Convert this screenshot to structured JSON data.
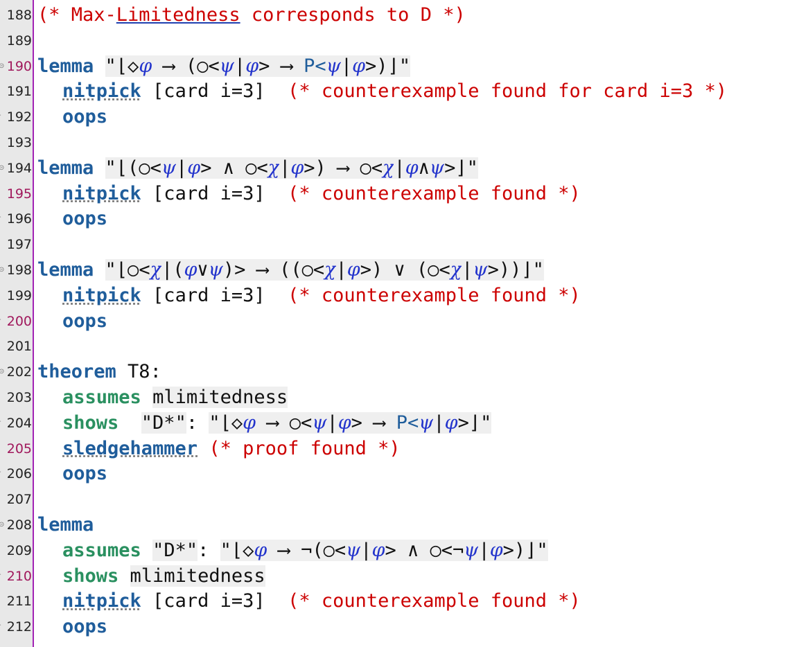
{
  "editor": {
    "lines": [
      {
        "num": "188",
        "modified": false,
        "fold": false,
        "indent": false,
        "parts": [
          {
            "t": "(* Max-",
            "c": "cm"
          },
          {
            "t": "Limitedness",
            "c": "cm link"
          },
          {
            "t": " corresponds to D *)",
            "c": "cm"
          }
        ]
      },
      {
        "num": "189",
        "modified": false,
        "fold": false,
        "indent": false,
        "parts": []
      },
      {
        "num": "190",
        "modified": true,
        "fold": true,
        "indent": false,
        "parts": [
          {
            "t": "lemma",
            "c": "kw"
          },
          {
            "t": " "
          },
          {
            "t": "\"⌊◇",
            "c": "str"
          },
          {
            "t": "φ",
            "c": "str var"
          },
          {
            "t": " ⟶ (○<",
            "c": "str"
          },
          {
            "t": "ψ",
            "c": "str var"
          },
          {
            "t": "|",
            "c": "str"
          },
          {
            "t": "φ",
            "c": "str var"
          },
          {
            "t": "> ⟶ ",
            "c": "str"
          },
          {
            "t": "P<",
            "c": "str P"
          },
          {
            "t": "ψ",
            "c": "str var"
          },
          {
            "t": "|",
            "c": "str"
          },
          {
            "t": "φ",
            "c": "str var"
          },
          {
            "t": ">)⌋\"",
            "c": "str"
          }
        ]
      },
      {
        "num": "191",
        "modified": false,
        "fold": false,
        "indent": true,
        "parts": [
          {
            "t": "nitpick",
            "c": "kw wavy"
          },
          {
            "t": " [card i=3]  "
          },
          {
            "t": "(* counterexample found for card i=3 *)",
            "c": "cm"
          }
        ]
      },
      {
        "num": "192",
        "modified": false,
        "fold": false,
        "indent": true,
        "dash": true,
        "parts": [
          {
            "t": "oops",
            "c": "kw"
          }
        ]
      },
      {
        "num": "193",
        "modified": false,
        "fold": false,
        "indent": false,
        "parts": []
      },
      {
        "num": "194",
        "modified": false,
        "fold": true,
        "indent": false,
        "parts": [
          {
            "t": "lemma",
            "c": "kw"
          },
          {
            "t": " "
          },
          {
            "t": "\"⌊(○<",
            "c": "str"
          },
          {
            "t": "ψ",
            "c": "str var"
          },
          {
            "t": "|",
            "c": "str"
          },
          {
            "t": "φ",
            "c": "str var"
          },
          {
            "t": "> ∧ ○<",
            "c": "str"
          },
          {
            "t": "χ",
            "c": "str var"
          },
          {
            "t": "|",
            "c": "str"
          },
          {
            "t": "φ",
            "c": "str var"
          },
          {
            "t": ">) ⟶ ○<",
            "c": "str"
          },
          {
            "t": "χ",
            "c": "str var"
          },
          {
            "t": "|",
            "c": "str"
          },
          {
            "t": "φ",
            "c": "str var"
          },
          {
            "t": "∧",
            "c": "str"
          },
          {
            "t": "ψ",
            "c": "str var"
          },
          {
            "t": ">⌋\"",
            "c": "str"
          }
        ]
      },
      {
        "num": "195",
        "modified": true,
        "fold": false,
        "indent": true,
        "parts": [
          {
            "t": "nitpick",
            "c": "kw wavy"
          },
          {
            "t": " [card i=3]  "
          },
          {
            "t": "(* counterexample found *)",
            "c": "cm"
          }
        ]
      },
      {
        "num": "196",
        "modified": false,
        "fold": false,
        "indent": true,
        "dash": true,
        "parts": [
          {
            "t": "oops",
            "c": "kw"
          }
        ]
      },
      {
        "num": "197",
        "modified": false,
        "fold": false,
        "indent": false,
        "parts": []
      },
      {
        "num": "198",
        "modified": false,
        "fold": true,
        "indent": false,
        "parts": [
          {
            "t": "lemma",
            "c": "kw"
          },
          {
            "t": " "
          },
          {
            "t": "\"⌊○<",
            "c": "str"
          },
          {
            "t": "χ",
            "c": "str var"
          },
          {
            "t": "|(",
            "c": "str"
          },
          {
            "t": "φ",
            "c": "str var"
          },
          {
            "t": "∨",
            "c": "str"
          },
          {
            "t": "ψ",
            "c": "str var"
          },
          {
            "t": ")> ⟶ ((○<",
            "c": "str"
          },
          {
            "t": "χ",
            "c": "str var"
          },
          {
            "t": "|",
            "c": "str"
          },
          {
            "t": "φ",
            "c": "str var"
          },
          {
            "t": ">) ∨ (○<",
            "c": "str"
          },
          {
            "t": "χ",
            "c": "str var"
          },
          {
            "t": "|",
            "c": "str"
          },
          {
            "t": "ψ",
            "c": "str var"
          },
          {
            "t": ">))⌋\"",
            "c": "str"
          }
        ]
      },
      {
        "num": "199",
        "modified": false,
        "fold": false,
        "indent": true,
        "parts": [
          {
            "t": "nitpick",
            "c": "kw wavy"
          },
          {
            "t": " [card i=3]  "
          },
          {
            "t": "(* counterexample found *)",
            "c": "cm"
          }
        ]
      },
      {
        "num": "200",
        "modified": true,
        "fold": false,
        "indent": true,
        "dash": true,
        "parts": [
          {
            "t": "oops",
            "c": "kw"
          }
        ]
      },
      {
        "num": "201",
        "modified": false,
        "fold": false,
        "indent": false,
        "parts": []
      },
      {
        "num": "202",
        "modified": false,
        "fold": true,
        "indent": false,
        "parts": [
          {
            "t": "theorem",
            "c": "kw"
          },
          {
            "t": " T8:"
          }
        ]
      },
      {
        "num": "203",
        "modified": false,
        "fold": false,
        "indent": true,
        "parts": [
          {
            "t": "assumes",
            "c": "kw2"
          },
          {
            "t": " "
          },
          {
            "t": "mlimitedness",
            "c": "str"
          }
        ]
      },
      {
        "num": "204",
        "modified": false,
        "fold": false,
        "indent": true,
        "dash": true,
        "parts": [
          {
            "t": "shows",
            "c": "kw2"
          },
          {
            "t": "  "
          },
          {
            "t": "\"D*\"",
            "c": "str"
          },
          {
            "t": ": "
          },
          {
            "t": "\"⌊◇",
            "c": "str"
          },
          {
            "t": "φ",
            "c": "str var"
          },
          {
            "t": " ⟶ ○<",
            "c": "str"
          },
          {
            "t": "ψ",
            "c": "str var"
          },
          {
            "t": "|",
            "c": "str"
          },
          {
            "t": "φ",
            "c": "str var"
          },
          {
            "t": "> ⟶ ",
            "c": "str"
          },
          {
            "t": "P<",
            "c": "str P"
          },
          {
            "t": "ψ",
            "c": "str var"
          },
          {
            "t": "|",
            "c": "str"
          },
          {
            "t": "φ",
            "c": "str var"
          },
          {
            "t": ">⌋\"",
            "c": "str"
          }
        ]
      },
      {
        "num": "205",
        "modified": true,
        "fold": false,
        "indent": true,
        "parts": [
          {
            "t": "sledgehammer",
            "c": "kw wavy"
          },
          {
            "t": " "
          },
          {
            "t": "(* proof found *)",
            "c": "cm"
          }
        ]
      },
      {
        "num": "206",
        "modified": false,
        "fold": false,
        "indent": true,
        "dash": true,
        "parts": [
          {
            "t": "oops",
            "c": "kw"
          }
        ]
      },
      {
        "num": "207",
        "modified": false,
        "fold": false,
        "indent": false,
        "parts": []
      },
      {
        "num": "208",
        "modified": false,
        "fold": true,
        "indent": false,
        "parts": [
          {
            "t": "lemma",
            "c": "kw"
          }
        ]
      },
      {
        "num": "209",
        "modified": false,
        "fold": false,
        "indent": true,
        "parts": [
          {
            "t": "assumes",
            "c": "kw2"
          },
          {
            "t": " "
          },
          {
            "t": "\"D*\"",
            "c": "str"
          },
          {
            "t": ": "
          },
          {
            "t": "\"⌊◇",
            "c": "str"
          },
          {
            "t": "φ",
            "c": "str var"
          },
          {
            "t": " ⟶ ¬(○<",
            "c": "str"
          },
          {
            "t": "ψ",
            "c": "str var"
          },
          {
            "t": "|",
            "c": "str"
          },
          {
            "t": "φ",
            "c": "str var"
          },
          {
            "t": "> ∧ ○<¬",
            "c": "str"
          },
          {
            "t": "ψ",
            "c": "str var"
          },
          {
            "t": "|",
            "c": "str"
          },
          {
            "t": "φ",
            "c": "str var"
          },
          {
            "t": ">)⌋\"",
            "c": "str"
          }
        ]
      },
      {
        "num": "210",
        "modified": true,
        "fold": false,
        "indent": true,
        "dash": true,
        "parts": [
          {
            "t": "shows",
            "c": "kw2"
          },
          {
            "t": " "
          },
          {
            "t": "mlimitedness",
            "c": "str"
          }
        ]
      },
      {
        "num": "211",
        "modified": false,
        "fold": false,
        "indent": true,
        "parts": [
          {
            "t": "nitpick",
            "c": "kw wavy"
          },
          {
            "t": " [card i=3]  "
          },
          {
            "t": "(* counterexample found *)",
            "c": "cm"
          }
        ]
      },
      {
        "num": "212",
        "modified": false,
        "fold": false,
        "indent": true,
        "dash": true,
        "parts": [
          {
            "t": "oops",
            "c": "kw"
          }
        ]
      }
    ]
  }
}
